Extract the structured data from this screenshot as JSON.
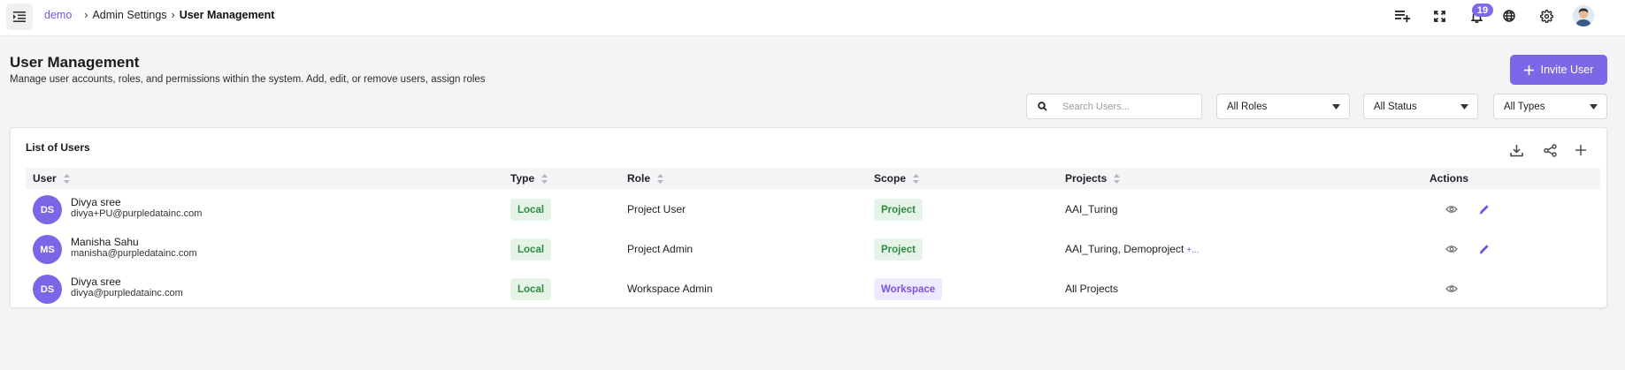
{
  "header": {
    "breadcrumb": {
      "root": "demo",
      "separator": "›",
      "middle": "Admin Settings",
      "current": "User Management"
    },
    "notification_count": "19",
    "icons": [
      "menu-collapse-icon",
      "playlist-add-icon",
      "fullscreen-icon",
      "bell-icon",
      "globe-icon",
      "gear-icon",
      "avatar"
    ]
  },
  "page": {
    "title": "User Management",
    "subtitle": "Manage user accounts, roles, and permissions within the system. Add, edit, or remove users, assign roles",
    "invite_button": "Invite User"
  },
  "filters": {
    "search_placeholder": "Search Users...",
    "roles": "All Roles",
    "status": "All Status",
    "types": "All Types"
  },
  "table": {
    "title": "List of Users",
    "columns": {
      "user": "User",
      "type": "Type",
      "role": "Role",
      "scope": "Scope",
      "projects": "Projects",
      "actions": "Actions"
    },
    "rows": [
      {
        "initials": "DS",
        "name": "Divya sree",
        "email": "divya+PU@purpledatainc.com",
        "type": "Local",
        "role": "Project User",
        "scope": "Project",
        "projects": "AAI_Turing",
        "more": "",
        "editable": true
      },
      {
        "initials": "MS",
        "name": "Manisha Sahu",
        "email": "manisha@purpledatainc.com",
        "type": "Local",
        "role": "Project Admin",
        "scope": "Project",
        "projects": "AAI_Turing, Demoproject",
        "more": "+...",
        "editable": true
      },
      {
        "initials": "DS",
        "name": "Divya sree",
        "email": "divya@purpledatainc.com",
        "type": "Local",
        "role": "Workspace Admin",
        "scope": "Workspace",
        "projects": "All Projects",
        "more": "",
        "editable": false
      }
    ]
  },
  "colors": {
    "accent": "#7b68e8",
    "local_tag_bg": "#e6f4e8",
    "local_tag_text": "#2f8a44",
    "workspace_tag_bg": "#efe9fd",
    "workspace_tag_text": "#7b53e0"
  }
}
